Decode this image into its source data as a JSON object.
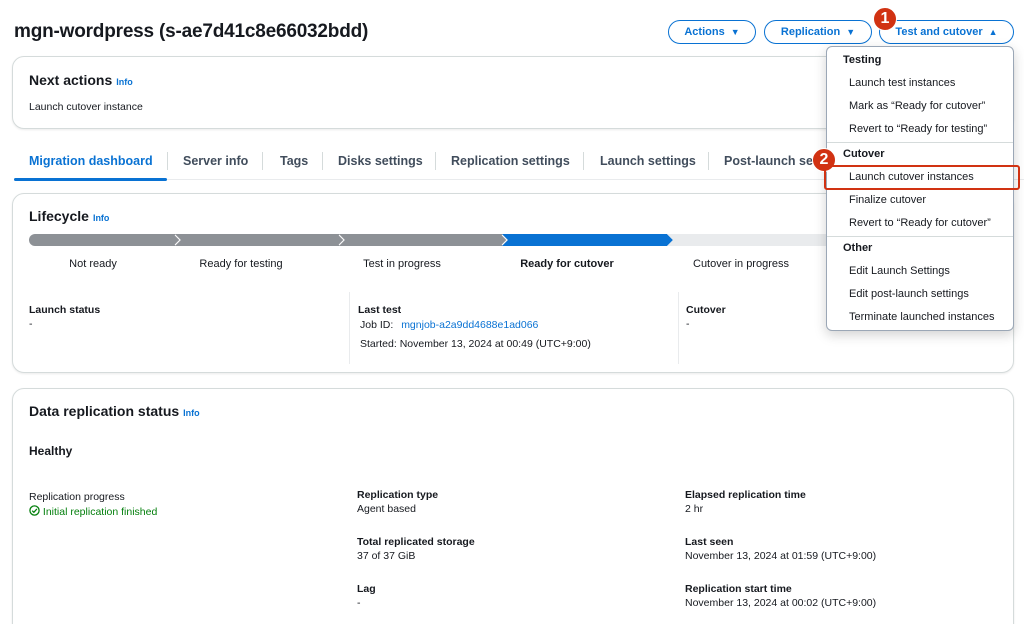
{
  "page": {
    "title": "mgn-wordpress (s-ae7d41c8e66032bdd)"
  },
  "header_buttons": {
    "actions": "Actions",
    "replication": "Replication",
    "test_and_cutover": "Test and cutover"
  },
  "step_badges": [
    "1",
    "2"
  ],
  "next_actions": {
    "title": "Next actions",
    "info": "Info",
    "text": "Launch cutover instance"
  },
  "tabs": [
    "Migration dashboard",
    "Server info",
    "Tags",
    "Disks settings",
    "Replication settings",
    "Launch settings",
    "Post-launch se"
  ],
  "lifecycle": {
    "title": "Lifecycle",
    "info": "Info",
    "stages": [
      "Not ready",
      "Ready for testing",
      "Test in progress",
      "Ready for cutover",
      "Cutover in progress"
    ],
    "current_stage": "Ready for cutover",
    "launch_status": {
      "label": "Launch status",
      "value": "-"
    },
    "last_test": {
      "label": "Last test",
      "job_label": "Job ID:",
      "job_id": "mgnjob-a2a9dd4688e1ad066",
      "started": "Started: November 13, 2024 at 00:49 (UTC+9:00)"
    },
    "cutover": {
      "label": "Cutover",
      "value": "-"
    }
  },
  "data_replication": {
    "title": "Data replication status",
    "info": "Info",
    "status": "Healthy",
    "progress_label": "Replication progress",
    "progress_value": "Initial replication finished",
    "type_label": "Replication type",
    "type_value": "Agent based",
    "storage_label": "Total replicated storage",
    "storage_value": "37 of 37 GiB",
    "lag_label": "Lag",
    "lag_value": "-",
    "elapsed_label": "Elapsed replication time",
    "elapsed_value": "2 hr",
    "last_seen_label": "Last seen",
    "last_seen_value": "November 13, 2024 at 01:59 (UTC+9:00)",
    "start_label": "Replication start time",
    "start_value": "November 13, 2024 at 00:02 (UTC+9:00)"
  },
  "menu": {
    "testing": {
      "header": "Testing",
      "items": [
        "Launch test instances",
        "Mark as “Ready for cutover”",
        "Revert to “Ready for testing”"
      ]
    },
    "cutover": {
      "header": "Cutover",
      "items": [
        "Launch cutover instances",
        "Finalize cutover",
        "Revert to “Ready for cutover”"
      ]
    },
    "other": {
      "header": "Other",
      "items": [
        "Edit Launch Settings",
        "Edit post-launch settings",
        "Terminate launched instances"
      ]
    }
  },
  "colors": {
    "accent": "#0972d3",
    "highlight": "#d13212",
    "progress_done": "#8d9196",
    "progress_current": "#0972d3",
    "progress_pending": "#e9ebed",
    "success": "#037f0c"
  }
}
